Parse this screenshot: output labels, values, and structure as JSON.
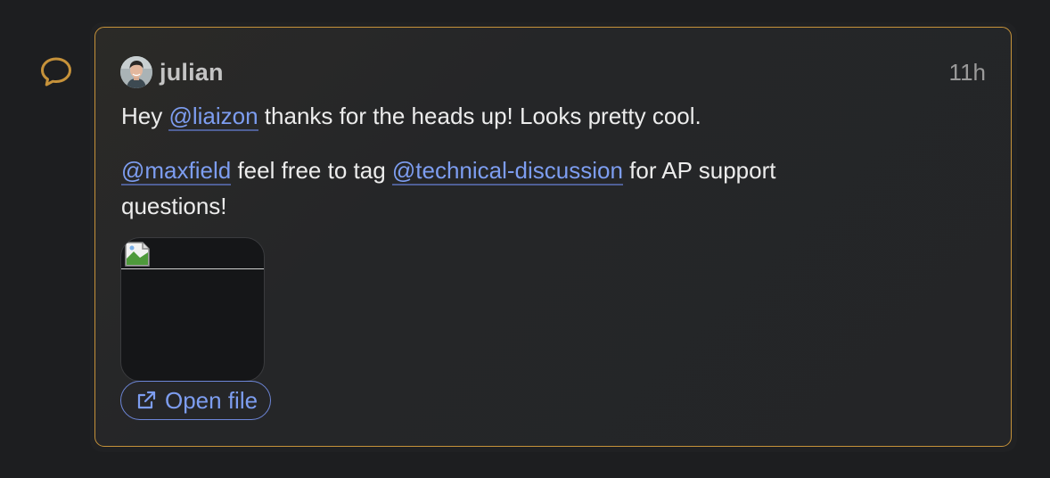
{
  "thread": {
    "comment_icon": "speech-bubble-icon",
    "accent_color": "#c6923a"
  },
  "comment": {
    "author": "julian",
    "avatar": "avatar-photo",
    "timestamp": "11h",
    "paragraph1": {
      "prefix": "Hey ",
      "mention": "@liaizon",
      "suffix": " thanks for the heads up! Looks pretty cool."
    },
    "paragraph2": {
      "mention1": "@maxfield",
      "middle": " feel free to tag ",
      "mention2": "@technical-discussion",
      "suffix": " for AP support questions!"
    },
    "attachment": {
      "icon": "broken-image-icon"
    },
    "open_file_label": "Open file",
    "open_file_icon": "external-link-icon",
    "mention_color": "#7d9df0"
  }
}
